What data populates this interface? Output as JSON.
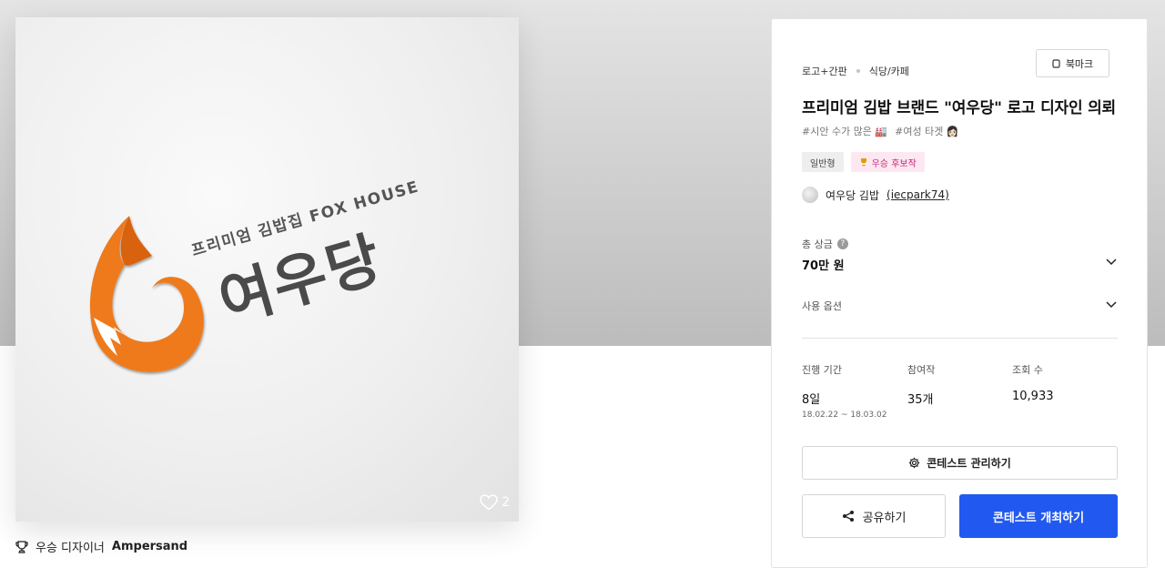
{
  "hero": {
    "artwork": {
      "tagline": "프리미엄 김밥집 FOX HOUSE",
      "brand": "여우당"
    },
    "like_count": "2"
  },
  "winner": {
    "label": "우승 디자이너",
    "name": "Ampersand"
  },
  "card": {
    "breadcrumbs": [
      "로고+간판",
      "식당/카페"
    ],
    "bookmark_label": "북마크",
    "title": "프리미엄 김밥 브랜드 \"여우당\" 로고 디자인 의뢰",
    "tags": [
      "#시안 수가 많은 🏭",
      "#여성 타겟 👩🏻"
    ],
    "badges": {
      "type": "일반형",
      "award": "우승 후보작"
    },
    "owner": {
      "name": "여우당 김밥",
      "handle": "(iecpark74)"
    },
    "prize": {
      "label": "총 상금",
      "value": "70만 원"
    },
    "usage_label": "사용 옵션",
    "stats": {
      "period_label": "진행 기간",
      "period_value": "8일",
      "period_range": "18.02.22 ~ 18.03.02",
      "entries_label": "참여작",
      "entries_value": "35개",
      "views_label": "조회 수",
      "views_value": "10,933"
    },
    "manage_label": "콘테스트 관리하기",
    "share_label": "공유하기",
    "host_label": "콘테스트 개최하기"
  },
  "colors": {
    "primary": "#2159f0",
    "fox_orange": "#ee7a1f",
    "award_pink": "#c8237a"
  },
  "icons": [
    "heart-icon",
    "trophy-icon",
    "bookmark-icon",
    "help-icon",
    "chevron-down-icon",
    "gear-icon",
    "share-icon"
  ]
}
